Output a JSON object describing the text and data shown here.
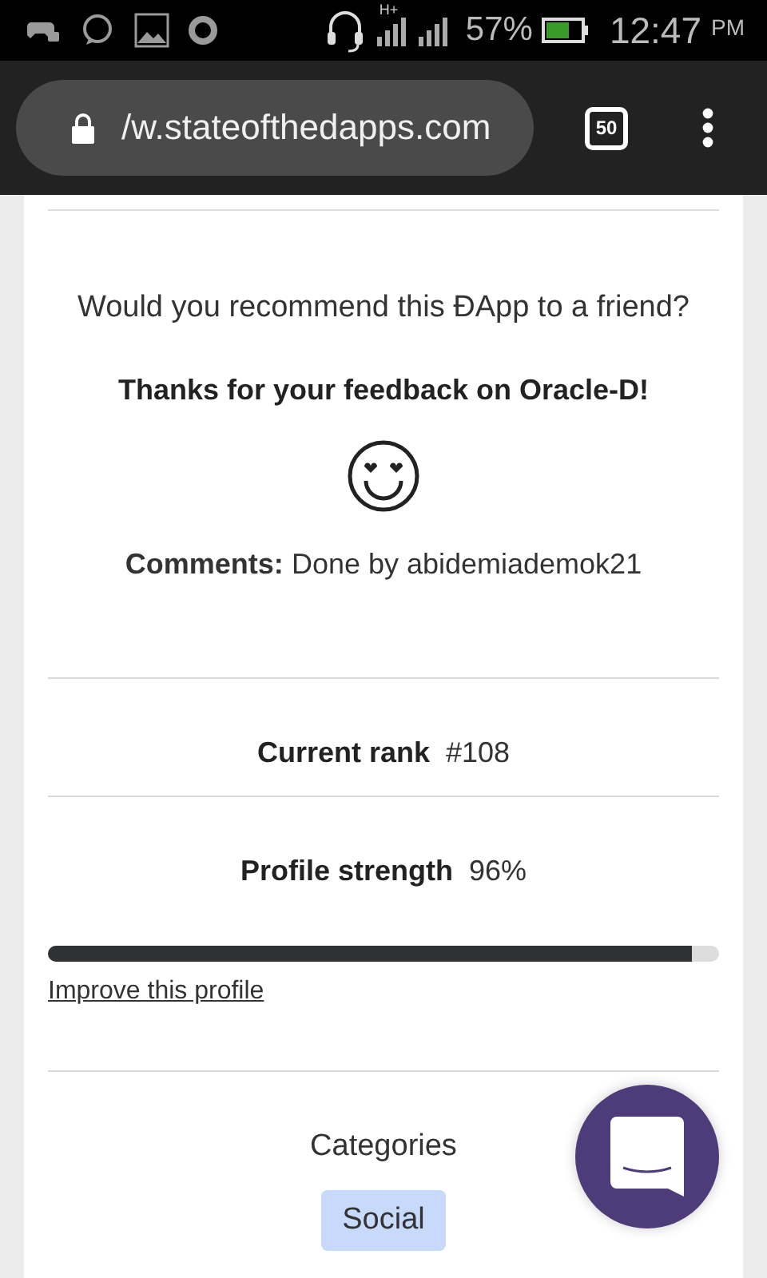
{
  "status_bar": {
    "network": "H+",
    "battery": "57%",
    "time": "12:47",
    "meridiem": "PM"
  },
  "browser": {
    "url": "/w.stateofthedapps.com",
    "tab_count": "50"
  },
  "feedback": {
    "question": "Would you recommend this ĐApp to a friend?",
    "thanks": "Thanks for your feedback on Oracle-D!",
    "comments_label": "Comments:",
    "comments": "Done by abidemiademok21"
  },
  "rank": {
    "label": "Current rank",
    "value": "#108"
  },
  "profile": {
    "label": "Profile strength",
    "value": "96%",
    "level": 0.96,
    "link": "Improve this profile"
  },
  "categories": {
    "title": "Categories",
    "tags": [
      "Social"
    ]
  }
}
